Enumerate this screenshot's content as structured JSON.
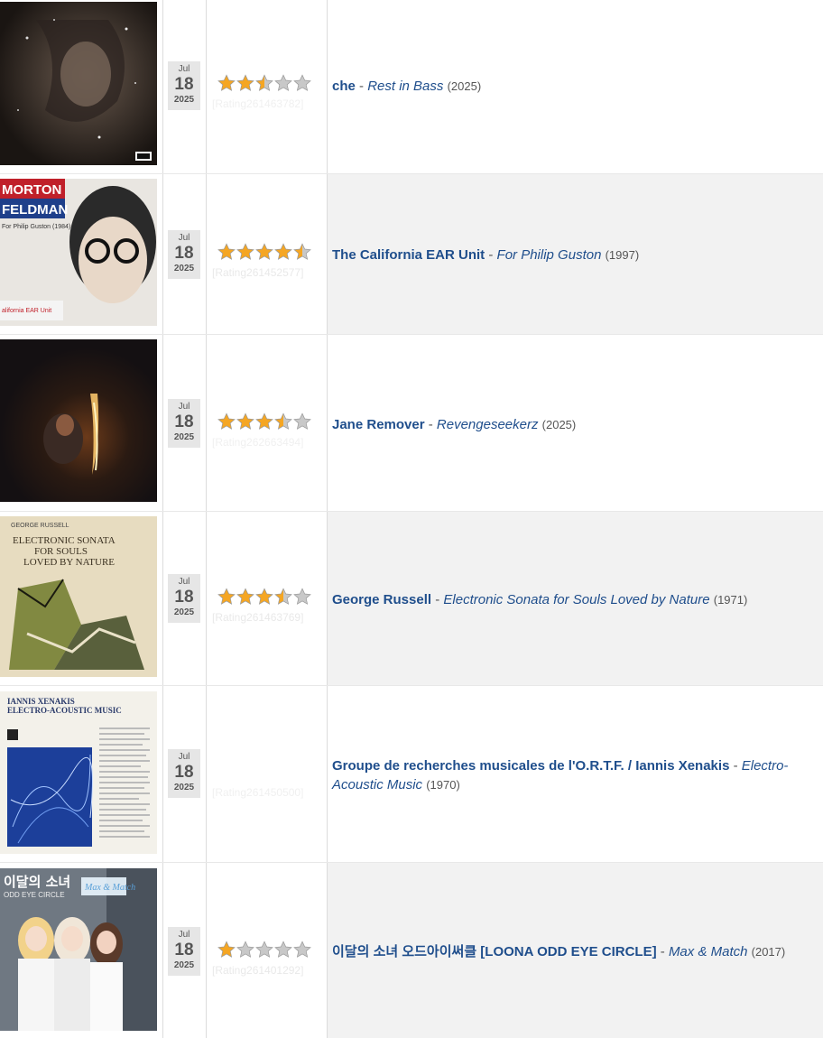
{
  "rows": [
    {
      "date": {
        "month": "Jul",
        "day": "18",
        "year": "2025"
      },
      "rating": 2.5,
      "rating_ghost": "[Rating261463782]",
      "artist": "che",
      "album": "Rest in Bass",
      "release_year": "(2025)"
    },
    {
      "date": {
        "month": "Jul",
        "day": "18",
        "year": "2025"
      },
      "rating": 4.5,
      "rating_ghost": "[Rating261452577]",
      "artist": "The California EAR Unit",
      "album": "For Philip Guston",
      "release_year": "(1997)"
    },
    {
      "date": {
        "month": "Jul",
        "day": "18",
        "year": "2025"
      },
      "rating": 3.5,
      "rating_ghost": "[Rating262663494]",
      "artist": "Jane Remover",
      "album": "Revengeseekerz",
      "release_year": "(2025)"
    },
    {
      "date": {
        "month": "Jul",
        "day": "18",
        "year": "2025"
      },
      "rating": 3.5,
      "rating_ghost": "[Rating261463769]",
      "artist": "George Russell",
      "album": "Electronic Sonata for Souls Loved by Nature",
      "release_year": "(1971)"
    },
    {
      "date": {
        "month": "Jul",
        "day": "18",
        "year": "2025"
      },
      "rating": 0,
      "rating_ghost": "[Rating261450500]",
      "artist": "Groupe de recherches musicales de l'O.R.T.F. / Iannis Xenakis",
      "album": "Electro-Acoustic Music",
      "release_year": "(1970)"
    },
    {
      "date": {
        "month": "Jul",
        "day": "18",
        "year": "2025"
      },
      "rating": 1,
      "rating_ghost": "[Rating261401292]",
      "artist": "이달의 소녀 오드아이써클 [LOONA ODD EYE CIRCLE]",
      "album": "Max & Match",
      "release_year": "(2017)"
    }
  ],
  "cover_text": {
    "feldman_top": "MORTON",
    "feldman_bottom": "FELDMAN",
    "feldman_sub": "For Philip Guston (1984)",
    "feldman_ear": "alifornia EAR Unit",
    "russell_line1": "ELECTRONIC SONATA",
    "russell_line2": "FOR SOULS",
    "russell_line3": "LOVED BY NATURE",
    "russell_name": "GEORGE RUSSELL",
    "xenakis_title": "IANNIS XENAKIS",
    "xenakis_sub": "ELECTRO-ACOUSTIC MUSIC",
    "loona_title": "이달의 소녀",
    "loona_sub": "ODD EYE CIRCLE",
    "loona_tag": "Max & Match"
  },
  "colors": {
    "link": "#1f4e8c",
    "star_fill": "#f5a623",
    "star_empty": "#c8c8c8",
    "alt_row": "#f2f2f2"
  }
}
